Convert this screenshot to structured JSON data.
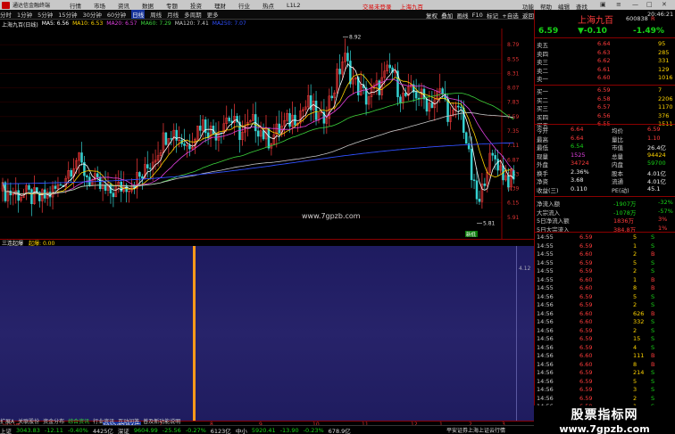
{
  "app": {
    "title": "通达信金融终端",
    "menu": [
      "行情",
      "市场",
      "资讯",
      "数据",
      "专题",
      "投资",
      "理财",
      "行业",
      "热点",
      "L1L2"
    ],
    "notice": "交易未登录",
    "notice_stock": "上海九百",
    "right_menu": [
      "功能",
      "帮助",
      "编辑",
      "查找"
    ]
  },
  "periods": [
    "分时",
    "1分钟",
    "5分钟",
    "15分钟",
    "30分钟",
    "60分钟",
    "日线",
    "周线",
    "月线",
    "多周期",
    "更多"
  ],
  "selected_period": "日线",
  "toolbar_right": [
    "复权",
    "叠加",
    "画线",
    "F10",
    "标记",
    "+自选",
    "返回"
  ],
  "stock_header": {
    "title": "上海九百(日线)"
  },
  "ma_legend": [
    {
      "label": "MA5: 6.56",
      "color": "#ffffff"
    },
    {
      "label": "MA10: 6.53",
      "color": "#ffd400"
    },
    {
      "label": "MA20: 6.57",
      "color": "#e040e0"
    },
    {
      "label": "MA60: 7.29",
      "color": "#3cd43c"
    },
    {
      "label": "MA120: 7.41",
      "color": "#c8c8c8"
    },
    {
      "label": "MA250: 7.07",
      "color": "#3050ff"
    }
  ],
  "chart_data": {
    "type": "candlestick",
    "y_ticks": [
      "8.79",
      "8.55",
      "8.31",
      "8.07",
      "7.83",
      "7.59",
      "7.35",
      "7.11",
      "6.87",
      "6.63",
      "6.39",
      "6.15",
      "5.91"
    ],
    "ylim": [
      5.81,
      8.92
    ],
    "high_label": "8.92",
    "low_label": "5.81",
    "date_labels": [
      "2023年",
      "2023/07/04/二",
      "7",
      "8",
      "9",
      "10",
      "11",
      "12",
      "1",
      "2",
      "3"
    ]
  },
  "indicator": {
    "name": "三连起爆",
    "sub": "起爆: 0.00",
    "axis": "4.12"
  },
  "watermark_center": "www.7gpzb.com",
  "marker_labels": [
    "新低"
  ],
  "tabs": [
    "指标",
    "窗口",
    "MACD",
    "VOL-TDX",
    "CCI",
    "趋势动力",
    "主力监控",
    "轧空主图",
    "MA2",
    "测试主图",
    "测试幅图A",
    "测试幅图B",
    "更多",
    "设置"
  ],
  "quote": {
    "time": "20:46:21",
    "name": "上海九百",
    "code": "600838",
    "flag": "R",
    "price": "6.59",
    "change": "-0.10",
    "pct": "-1.49%",
    "asks": [
      {
        "label": "卖五",
        "price": "6.64",
        "vol": "95"
      },
      {
        "label": "卖四",
        "price": "6.63",
        "vol": "285"
      },
      {
        "label": "卖三",
        "price": "6.62",
        "vol": "331"
      },
      {
        "label": "卖二",
        "price": "6.61",
        "vol": "129"
      },
      {
        "label": "卖一",
        "price": "6.60",
        "vol": "1016"
      }
    ],
    "bids": [
      {
        "label": "买一",
        "price": "6.59",
        "vol": "7"
      },
      {
        "label": "买二",
        "price": "6.58",
        "vol": "2206"
      },
      {
        "label": "买三",
        "price": "6.57",
        "vol": "1170"
      },
      {
        "label": "买四",
        "price": "6.56",
        "vol": "376"
      },
      {
        "label": "买五",
        "price": "6.55",
        "vol": "1511"
      }
    ],
    "stats": [
      {
        "l1": "今开",
        "v1": "6.64",
        "c1": "red",
        "l2": "均价",
        "v2": "6.59",
        "c2": "red"
      },
      {
        "l1": "最高",
        "v1": "6.64",
        "c1": "red",
        "l2": "量比",
        "v2": "1.10",
        "c2": "red"
      },
      {
        "l1": "最低",
        "v1": "6.54",
        "c1": "green",
        "l2": "市值",
        "v2": "26.4亿",
        "c2": "white"
      },
      {
        "l1": "现量",
        "v1": "1525",
        "c1": "mag",
        "l2": "总量",
        "v2": "94424",
        "c2": "yellow"
      },
      {
        "l1": "外盘",
        "v1": "34724",
        "c1": "red",
        "l2": "内盘",
        "v2": "59700",
        "c2": "green"
      },
      {
        "l1": "换手",
        "v1": "2.36%",
        "c1": "white",
        "l2": "股本",
        "v2": "4.01亿",
        "c2": "white"
      },
      {
        "l1": "净资",
        "v1": "3.68",
        "c1": "white",
        "l2": "流通",
        "v2": "4.01亿",
        "c2": "white"
      },
      {
        "l1": "收益(三)",
        "v1": "0.110",
        "c1": "white",
        "l2": "PE(动)",
        "v2": "45.1",
        "c2": "white"
      }
    ],
    "flows": [
      {
        "label": "净流入额",
        "value": "-1907万",
        "pct": "-32%",
        "color": "green"
      },
      {
        "label": "大宗流入",
        "value": "-1078万",
        "pct": "-57%",
        "color": "green"
      },
      {
        "label": "5日净流入额",
        "value": "1836万",
        "pct": "3%",
        "color": "red"
      },
      {
        "label": "5日大宗流入",
        "value": "384.8万",
        "pct": "1%",
        "color": "red"
      }
    ],
    "ticks": [
      {
        "t": "14:55",
        "p": "6.59",
        "v": "5",
        "d": "S"
      },
      {
        "t": "14:55",
        "p": "6.59",
        "v": "1",
        "d": "S"
      },
      {
        "t": "14:55",
        "p": "6.60",
        "v": "2",
        "d": "B"
      },
      {
        "t": "14:55",
        "p": "6.59",
        "v": "5",
        "d": "S"
      },
      {
        "t": "14:55",
        "p": "6.59",
        "v": "2",
        "d": "S"
      },
      {
        "t": "14:55",
        "p": "6.60",
        "v": "1",
        "d": "B"
      },
      {
        "t": "14:55",
        "p": "6.60",
        "v": "8",
        "d": "B"
      },
      {
        "t": "14:56",
        "p": "6.59",
        "v": "5",
        "d": "S"
      },
      {
        "t": "14:56",
        "p": "6.59",
        "v": "2",
        "d": "S"
      },
      {
        "t": "14:56",
        "p": "6.60",
        "v": "626",
        "d": "B"
      },
      {
        "t": "14:56",
        "p": "6.60",
        "v": "332",
        "d": "S"
      },
      {
        "t": "14:56",
        "p": "6.59",
        "v": "2",
        "d": "S"
      },
      {
        "t": "14:56",
        "p": "6.59",
        "v": "15",
        "d": "S"
      },
      {
        "t": "14:56",
        "p": "6.59",
        "v": "4",
        "d": "S"
      },
      {
        "t": "14:56",
        "p": "6.60",
        "v": "111",
        "d": "B"
      },
      {
        "t": "14:56",
        "p": "6.60",
        "v": "8",
        "d": "B"
      },
      {
        "t": "14:56",
        "p": "6.59",
        "v": "214",
        "d": "S"
      },
      {
        "t": "14:56",
        "p": "6.59",
        "v": "5",
        "d": "S"
      },
      {
        "t": "14:56",
        "p": "6.59",
        "v": "3",
        "d": "S"
      },
      {
        "t": "14:56",
        "p": "6.59",
        "v": "2",
        "d": "S"
      },
      {
        "t": "14:56",
        "p": "6.59",
        "v": "1",
        "d": "S"
      },
      {
        "t": "14:56",
        "p": "6.59",
        "v": "1",
        "d": "S"
      },
      {
        "t": "15:00",
        "p": "6.59",
        "v": "1",
        "d": "S"
      }
    ]
  },
  "statusbar": {
    "left_tabs": [
      "扩展A",
      "关联股份",
      "资金分布",
      "综合资讯",
      "行业资讯",
      "互动问答",
      "普及新功能说明"
    ],
    "items": [
      {
        "name": "上证",
        "val": "3043.83",
        "chg": "-12.11",
        "pct": "-0.40%",
        "amt": "4425亿"
      },
      {
        "name": "深证",
        "val": "9604.99",
        "chg": "-25.56",
        "pct": "-0.27%",
        "amt": "6123亿"
      },
      {
        "name": "中小",
        "val": "5920.41",
        "chg": "-13.90",
        "pct": "-0.23%",
        "amt": "678.9亿"
      }
    ],
    "right": "平安证券上海上证云行情"
  },
  "watermark": {
    "big": "股票指标网",
    "small": "www.7gpzb.com"
  }
}
